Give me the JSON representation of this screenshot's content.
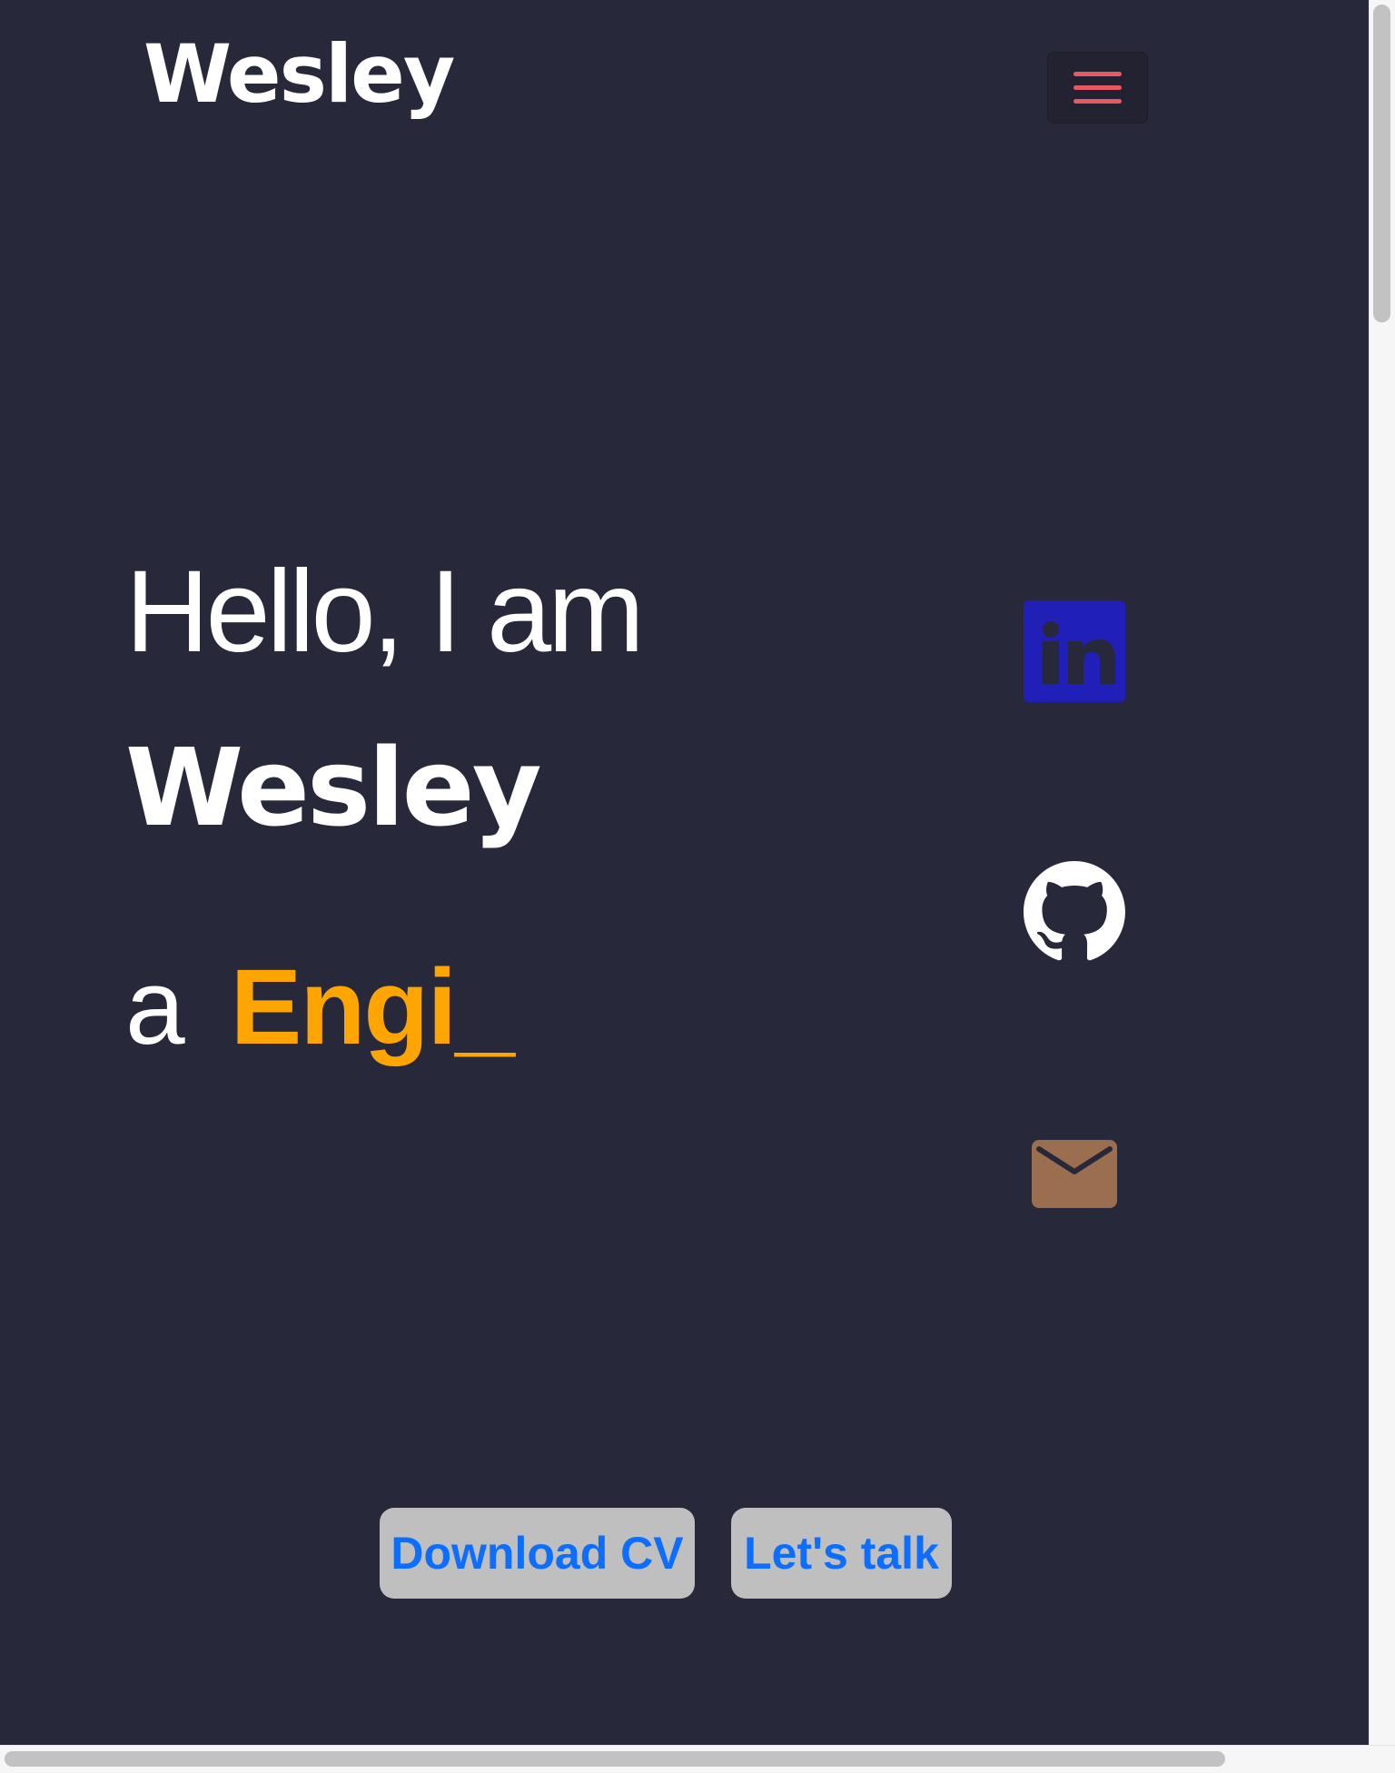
{
  "navbar": {
    "brand": "Wesley",
    "menu_toggle_icon": "hamburger-menu-icon",
    "menu_toggle_color": "#e75a64"
  },
  "hero": {
    "greeting": "Hello, I am",
    "name": "Wesley",
    "role_prefix": "a",
    "role_typed": "Engi_",
    "role_color": "#ffa502"
  },
  "social": [
    {
      "icon": "linkedin-icon",
      "color": "#2020b8"
    },
    {
      "icon": "github-icon",
      "color": "#ffffff"
    },
    {
      "icon": "mail-icon",
      "color": "#9c6e50"
    }
  ],
  "actions": {
    "download_cv": "Download CV",
    "lets_talk": "Let's talk"
  },
  "theme": {
    "background": "#27283a",
    "button_bg": "#bfbfbf",
    "button_text": "#0d6efd"
  }
}
